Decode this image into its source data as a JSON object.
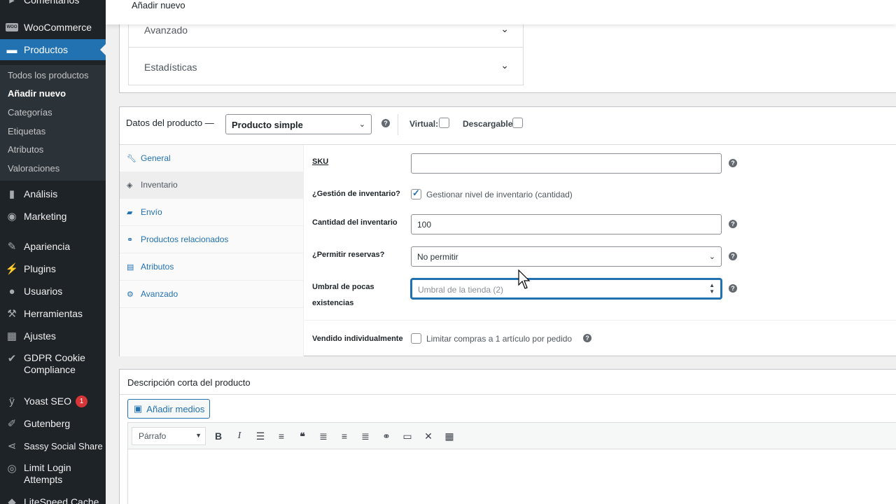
{
  "sidebar": {
    "top_partial": "Comentarios",
    "woocommerce": "WooCommerce",
    "woo_icon_text": "WOO",
    "productos": "Productos",
    "sub": [
      "Todos los productos",
      "Añadir nuevo",
      "Categorías",
      "Etiquetas",
      "Atributos",
      "Valoraciones"
    ],
    "analisis": "Análisis",
    "marketing": "Marketing",
    "apariencia": "Apariencia",
    "plugins": "Plugins",
    "usuarios": "Usuarios",
    "herramientas": "Herramientas",
    "ajustes": "Ajustes",
    "gdpr": "GDPR Cookie Compliance",
    "yoast": "Yoast SEO",
    "yoast_badge": "1",
    "gutenberg": "Gutenberg",
    "sassy": "Sassy Social Share",
    "limit_login": "Limit Login Attempts",
    "litespeed": "LiteSpeed Cache"
  },
  "header": {
    "title": "Añadir nuevo"
  },
  "upper_panel": {
    "accordions": [
      {
        "label": "Avanzado",
        "icon": "chevron-down-icon"
      },
      {
        "label": "Estadísticas",
        "icon": "chevron-down-icon"
      }
    ]
  },
  "product_data": {
    "title": "Datos del producto —",
    "type_selected": "Producto simple",
    "virtual_label": "Virtual:",
    "virtual_checked": false,
    "downloadable_label": "Descargable:",
    "downloadable_checked": false,
    "help_glyph": "?",
    "tabs": [
      "General",
      "Inventario",
      "Envío",
      "Productos relacionados",
      "Atributos",
      "Avanzado"
    ],
    "active_tab": "Inventario",
    "fields": {
      "sku_label": "SKU",
      "sku_value": "",
      "manage_stock_label": "¿Gestión de inventario?",
      "manage_stock_text": "Gestionar nivel de inventario (cantidad)",
      "manage_stock_checked": true,
      "stock_qty_label": "Cantidad del inventario",
      "stock_qty_value": "100",
      "backorders_label": "¿Permitir reservas?",
      "backorders_value": "No permitir",
      "low_stock_label": "Umbral de pocas existencias",
      "low_stock_placeholder": "Umbral de la tienda (2)",
      "sold_individually_label": "Vendido individualmente",
      "sold_individually_text": "Limitar compras a 1 artículo por pedido",
      "sold_individually_checked": false
    }
  },
  "short_description": {
    "title": "Descripción corta del producto",
    "add_media": "Añadir medios",
    "format_selected": "Párrafo",
    "toolbar_buttons": [
      "bold-icon",
      "italic-icon",
      "bullet-list-icon",
      "numbered-list-icon",
      "blockquote-icon",
      "align-left-icon",
      "align-center-icon",
      "align-right-icon",
      "link-icon",
      "read-more-icon",
      "fullscreen-icon",
      "toolbar-toggle-icon"
    ]
  },
  "colors": {
    "accent": "#2271b1",
    "sidebar_bg": "#1d2327",
    "badge": "#d63638"
  }
}
